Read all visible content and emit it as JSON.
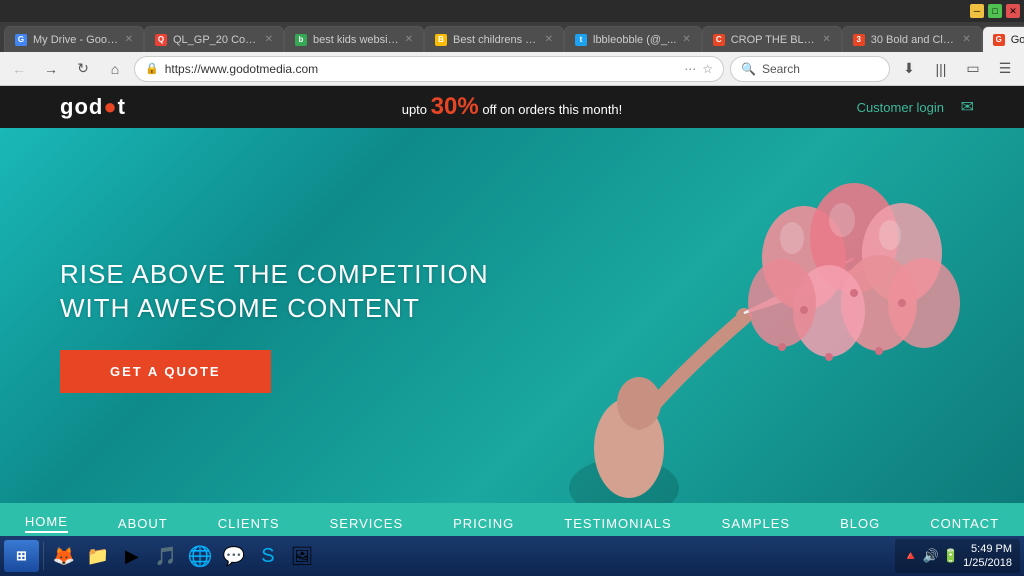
{
  "browser": {
    "title_bar": {
      "minimize": "─",
      "maximize": "□",
      "close": "✕"
    },
    "tabs": [
      {
        "id": "tab1",
        "label": "My Drive - Goog...",
        "favicon_color": "#4285f4",
        "favicon_letter": "G",
        "active": false
      },
      {
        "id": "tab2",
        "label": "QL_GP_20 Cool ...",
        "favicon_color": "#ea4335",
        "favicon_letter": "Q",
        "active": false
      },
      {
        "id": "tab3",
        "label": "best kids websit...",
        "favicon_color": "#34a853",
        "favicon_letter": "b",
        "active": false
      },
      {
        "id": "tab4",
        "label": "Best childrens a...",
        "favicon_color": "#fbbc05",
        "favicon_letter": "B",
        "active": false
      },
      {
        "id": "tab5",
        "label": "lbbleobble (@_...",
        "favicon_color": "#1da1f2",
        "favicon_letter": "t",
        "active": false
      },
      {
        "id": "tab6",
        "label": "CROP THE BLO...",
        "favicon_color": "#e84525",
        "favicon_letter": "C",
        "active": false
      },
      {
        "id": "tab7",
        "label": "30 Bold and Cle...",
        "favicon_color": "#e84525",
        "favicon_letter": "3",
        "active": false
      },
      {
        "id": "tab8",
        "label": "Godot Content ...",
        "favicon_color": "#e84525",
        "favicon_letter": "G",
        "active": true
      }
    ],
    "address_bar": {
      "url": "https://www.godotmedia.com",
      "search_placeholder": "Search"
    }
  },
  "website": {
    "logo": "godot",
    "logo_dot_color": "#e84525",
    "promo": {
      "prefix": "upto",
      "percent": "30%",
      "suffix": "off on orders this month!"
    },
    "customer_login": "Customer login",
    "hero": {
      "headline_line1": "RISE ABOVE THE COMPETITION",
      "headline_line2": "WITH AWESOME CONTENT",
      "cta_label": "GET A QUOTE"
    },
    "nav": [
      {
        "label": "HOME",
        "active": true
      },
      {
        "label": "ABOUT",
        "active": false
      },
      {
        "label": "CLIENTS",
        "active": false
      },
      {
        "label": "SERVICES",
        "active": false
      },
      {
        "label": "PRICING",
        "active": false
      },
      {
        "label": "TESTIMONIALS",
        "active": false
      },
      {
        "label": "SAMPLES",
        "active": false
      },
      {
        "label": "BLOG",
        "active": false
      },
      {
        "label": "CONTACT",
        "active": false
      }
    ]
  },
  "taskbar": {
    "time": "5:49 PM",
    "date": "1/25/2018",
    "icons": [
      "🪟",
      "🔥",
      "📁",
      "▶",
      "🎵",
      "🌐",
      "💬",
      "🖼"
    ]
  }
}
